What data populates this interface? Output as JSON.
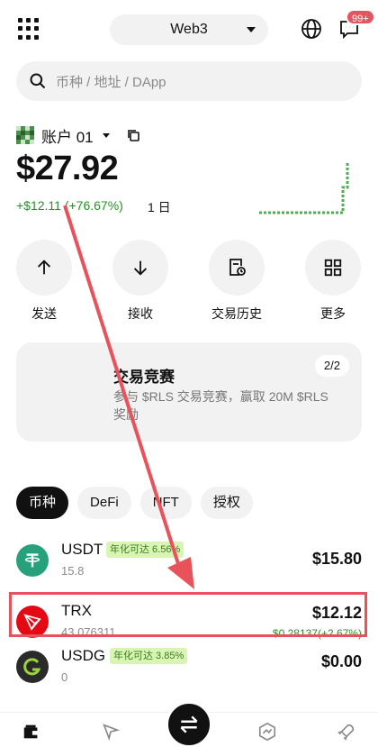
{
  "header": {
    "network_label": "Web3",
    "notification_badge": "99+"
  },
  "search": {
    "placeholder": "币种 / 地址 / DApp"
  },
  "account": {
    "name": "账户 01",
    "balance": "$27.92",
    "change": "+$12.11 (+76.67%)",
    "period": "1 日"
  },
  "actions": [
    {
      "label": "发送",
      "icon": "arrow-up-icon"
    },
    {
      "label": "接收",
      "icon": "arrow-down-icon"
    },
    {
      "label": "交易历史",
      "icon": "history-icon"
    },
    {
      "label": "更多",
      "icon": "grid-icon"
    }
  ],
  "promo": {
    "title": "交易竞赛",
    "description": "参与 $RLS 交易竞赛，赢取 20M $RLS 奖励",
    "page": "2/2"
  },
  "tabs": [
    "币种",
    "DeFi",
    "NFT",
    "授权"
  ],
  "assets": [
    {
      "symbol": "USDT",
      "yield": "年化可达 6.56%",
      "amount": "15.8",
      "value": "$15.80",
      "change": "",
      "color": "#26a17b"
    },
    {
      "symbol": "TRX",
      "yield": "",
      "amount": "43.076311",
      "value": "$12.12",
      "change": "$0.28137(+2.67%)",
      "color": "#e50914"
    },
    {
      "symbol": "USDG",
      "yield": "年化可达 3.85%",
      "amount": "0",
      "value": "$0.00",
      "change": "",
      "color": "#2a2a2a"
    }
  ],
  "colors": {
    "positive": "#2a8f2a",
    "annotation": "#e8525a",
    "badge": "#e4555f",
    "yield_bg": "#d9f5b5"
  }
}
